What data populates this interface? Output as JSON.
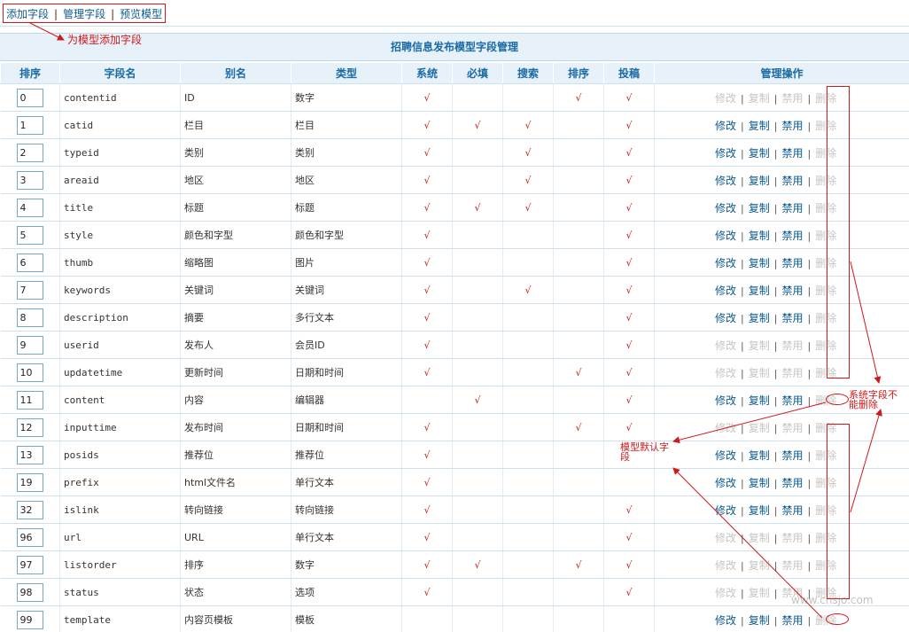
{
  "nav": {
    "items": [
      "添加字段",
      "管理字段",
      "预览模型"
    ],
    "separator": "|"
  },
  "annotations": {
    "add_field_note": "为模型添加字段",
    "system_field_note": "系统字段不能删除",
    "default_field_note": "模型默认字段"
  },
  "title": "招聘信息发布模型字段管理",
  "columns": [
    "排序",
    "字段名",
    "别名",
    "类型",
    "系统",
    "必填",
    "搜索",
    "排序",
    "投稿",
    "管理操作"
  ],
  "tick_char": "√",
  "ops_labels": [
    "修改",
    "复制",
    "禁用",
    "删除"
  ],
  "rows": [
    {
      "order": "0",
      "name": "contentid",
      "alias": "ID",
      "type": "数字",
      "sys": true,
      "req": false,
      "search": false,
      "sort": true,
      "sub": true,
      "ops_enabled": false
    },
    {
      "order": "1",
      "name": "catid",
      "alias": "栏目",
      "type": "栏目",
      "sys": true,
      "req": true,
      "search": true,
      "sort": false,
      "sub": true,
      "ops_enabled": true
    },
    {
      "order": "2",
      "name": "typeid",
      "alias": "类别",
      "type": "类别",
      "sys": true,
      "req": false,
      "search": true,
      "sort": false,
      "sub": true,
      "ops_enabled": true
    },
    {
      "order": "3",
      "name": "areaid",
      "alias": "地区",
      "type": "地区",
      "sys": true,
      "req": false,
      "search": true,
      "sort": false,
      "sub": true,
      "ops_enabled": true
    },
    {
      "order": "4",
      "name": "title",
      "alias": "标题",
      "type": "标题",
      "sys": true,
      "req": true,
      "search": true,
      "sort": false,
      "sub": true,
      "ops_enabled": true
    },
    {
      "order": "5",
      "name": "style",
      "alias": "颜色和字型",
      "type": "颜色和字型",
      "sys": true,
      "req": false,
      "search": false,
      "sort": false,
      "sub": true,
      "ops_enabled": true
    },
    {
      "order": "6",
      "name": "thumb",
      "alias": "缩略图",
      "type": "图片",
      "sys": true,
      "req": false,
      "search": false,
      "sort": false,
      "sub": true,
      "ops_enabled": true
    },
    {
      "order": "7",
      "name": "keywords",
      "alias": "关键词",
      "type": "关键词",
      "sys": true,
      "req": false,
      "search": true,
      "sort": false,
      "sub": true,
      "ops_enabled": true
    },
    {
      "order": "8",
      "name": "description",
      "alias": "摘要",
      "type": "多行文本",
      "sys": true,
      "req": false,
      "search": false,
      "sort": false,
      "sub": true,
      "ops_enabled": true
    },
    {
      "order": "9",
      "name": "userid",
      "alias": "发布人",
      "type": "会员ID",
      "sys": true,
      "req": false,
      "search": false,
      "sort": false,
      "sub": true,
      "ops_enabled": false
    },
    {
      "order": "10",
      "name": "updatetime",
      "alias": "更新时间",
      "type": "日期和时间",
      "sys": true,
      "req": false,
      "search": false,
      "sort": true,
      "sub": true,
      "ops_enabled": false
    },
    {
      "order": "11",
      "name": "content",
      "alias": "内容",
      "type": "编辑器",
      "sys": false,
      "req": true,
      "search": false,
      "sort": false,
      "sub": true,
      "ops_enabled": true
    },
    {
      "order": "12",
      "name": "inputtime",
      "alias": "发布时间",
      "type": "日期和时间",
      "sys": true,
      "req": false,
      "search": false,
      "sort": true,
      "sub": true,
      "ops_enabled": false
    },
    {
      "order": "13",
      "name": "posids",
      "alias": "推荐位",
      "type": "推荐位",
      "sys": true,
      "req": false,
      "search": false,
      "sort": false,
      "sub": false,
      "ops_enabled": true
    },
    {
      "order": "19",
      "name": "prefix",
      "alias": "html文件名",
      "type": "单行文本",
      "sys": true,
      "req": false,
      "search": false,
      "sort": false,
      "sub": false,
      "ops_enabled": true
    },
    {
      "order": "32",
      "name": "islink",
      "alias": "转向链接",
      "type": "转向链接",
      "sys": true,
      "req": false,
      "search": false,
      "sort": false,
      "sub": true,
      "ops_enabled": true
    },
    {
      "order": "96",
      "name": "url",
      "alias": "URL",
      "type": "单行文本",
      "sys": true,
      "req": false,
      "search": false,
      "sort": false,
      "sub": true,
      "ops_enabled": false
    },
    {
      "order": "97",
      "name": "listorder",
      "alias": "排序",
      "type": "数字",
      "sys": true,
      "req": true,
      "search": false,
      "sort": true,
      "sub": true,
      "ops_enabled": false
    },
    {
      "order": "98",
      "name": "status",
      "alias": "状态",
      "type": "选项",
      "sys": true,
      "req": false,
      "search": false,
      "sort": false,
      "sub": true,
      "ops_enabled": false
    },
    {
      "order": "99",
      "name": "template",
      "alias": "内容页模板",
      "type": "模板",
      "sys": false,
      "req": false,
      "search": false,
      "sort": false,
      "sub": false,
      "ops_enabled": true
    }
  ],
  "watermark": "www.cnsjo.com",
  "colors": {
    "accent": "#1a6aa3",
    "link": "#0b5a8f",
    "annotation": "#d01818",
    "header_bg": "#e6f1fa",
    "disabled": "#c5c5c5"
  }
}
